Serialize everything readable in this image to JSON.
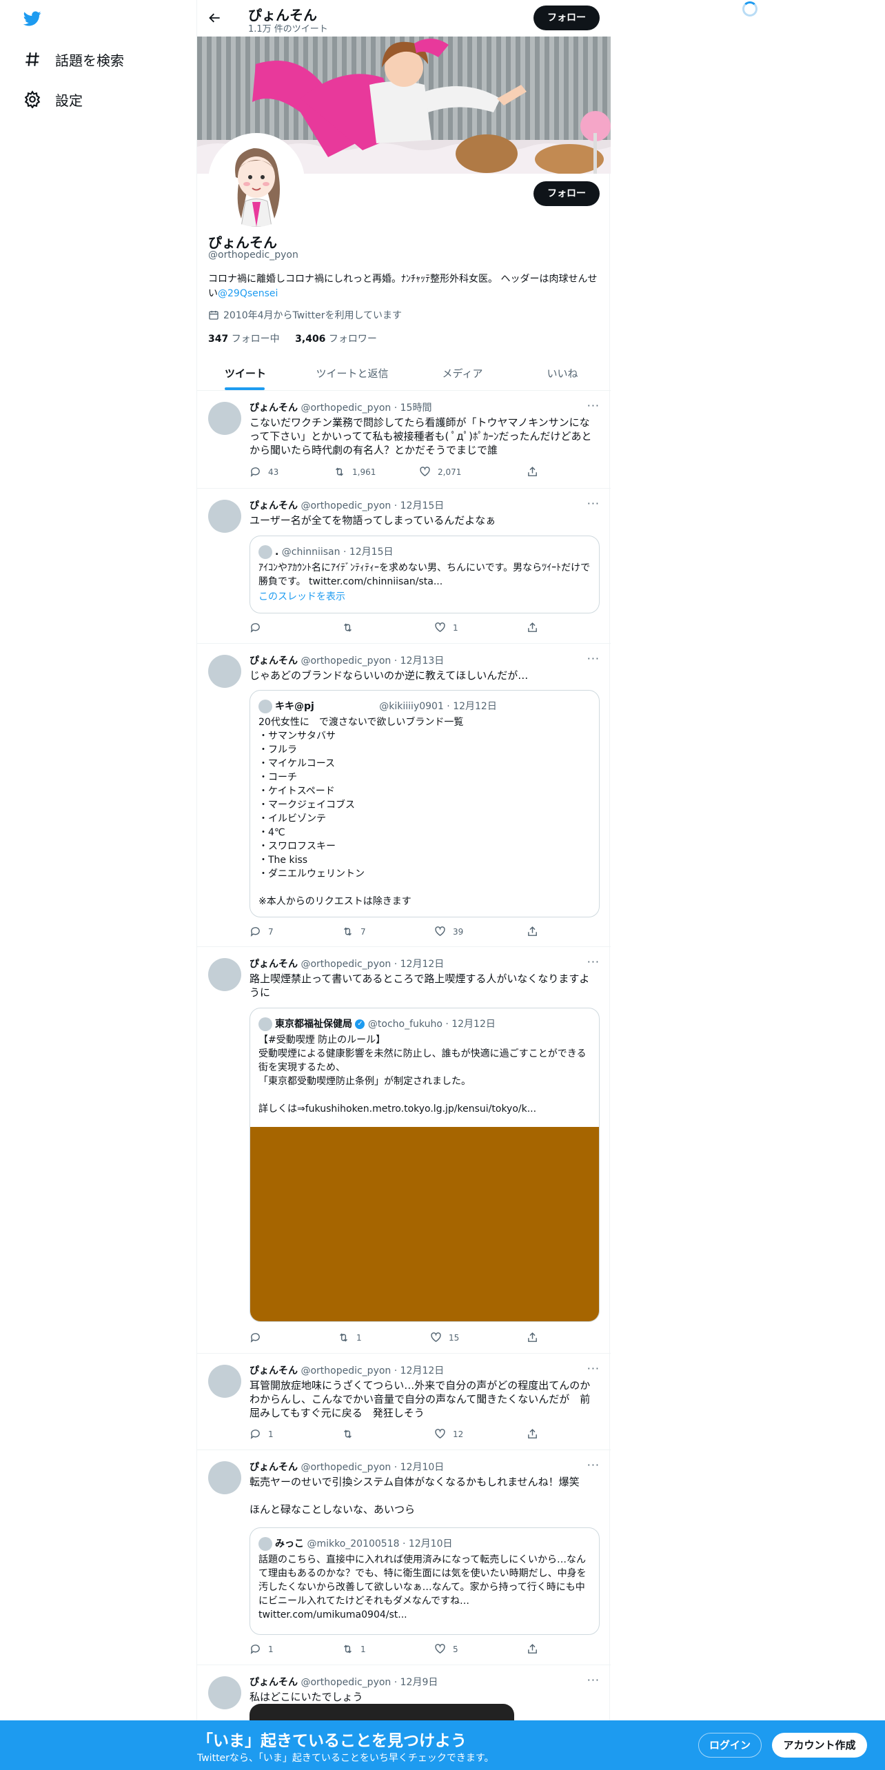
{
  "nav": {
    "explore_label": "話題を検索",
    "settings_label": "設定"
  },
  "header": {
    "name": "ぴょんそん",
    "tweet_count": "1.1万 件のツイート",
    "follow_label": "フォロー"
  },
  "profile": {
    "name": "ぴょんそん",
    "handle": "@orthopedic_pyon",
    "bio": "コロナ禍に離婚しコロナ禍にしれっと再婚。ﾅﾝﾁｬｯﾃ整形外科女医。 ヘッダーは肉球せんせい",
    "bio_link": "@29Qsensei",
    "joined": "2010年4月からTwitterを利用しています",
    "following_count": "347",
    "following_label": "フォロー中",
    "followers_count": "3,406",
    "followers_label": "フォロワー",
    "follow_label": "フォロー"
  },
  "tabs": [
    "ツイート",
    "ツイートと返信",
    "メディア",
    "いいね"
  ],
  "tweets": [
    {
      "name": "ぴょんそん",
      "meta": "@orthopedic_pyon · 15時間",
      "text": "こないだワクチン業務で問診してたら看護師が「トウヤマノキンサンになって下さい」とかいってて私も被接種者も( ﾟдﾟ)ﾎﾟｶｰﾝだったんだけどあとから聞いたら時代劇の有名人？とかだそうでまじで誰",
      "reply": "43",
      "retweet": "1,961",
      "like": "2,071"
    },
    {
      "name": "ぴょんそん",
      "meta": "@orthopedic_pyon · 12月15日",
      "text": "ユーザー名が全てを物語ってしまっているんだよなぁ",
      "reply": "",
      "retweet": "",
      "like": "1",
      "quote": {
        "name": ".",
        "meta": "@chinniisan · 12月15日",
        "text": "ｱｲｺﾝやｱｶｳﾝﾄ名にｱｲﾃﾞﾝﾃｨﾃｨｰを求めない男、ちんにいです。男ならﾂｲｰﾄだけで勝負です。 twitter.com/chinniisan/sta...",
        "thread": "このスレッドを表示"
      }
    },
    {
      "name": "ぴょんそん",
      "meta": "@orthopedic_pyon · 12月13日",
      "text": "じゃあどのブランドならいいのか逆に教えてほしいんだが…",
      "reply": "7",
      "retweet": "7",
      "like": "39",
      "quote": {
        "name": "キキ@pj",
        "meta": "@kikiiiiy0901 · 12月12日",
        "text": "20代女性に　で渡さないで欲しいブランド一覧\n・サマンサタバサ\n・フルラ\n・マイケルコース\n・コーチ\n・ケイトスペード\n・マークジェイコブス\n・イルビゾンテ\n・4℃\n・スワロフスキー\n・The kiss\n・ダニエルウェリントン\n\n※本人からのリクエストは除きます"
      }
    },
    {
      "name": "ぴょんそん",
      "meta": "@orthopedic_pyon · 12月12日",
      "text": "路上喫煙禁止って書いてあるところで路上喫煙する人がいなくなりますように",
      "reply": "",
      "retweet": "1",
      "like": "15",
      "quote": {
        "name": "東京都福祉保健局",
        "meta": "@tocho_fukuho · 12月12日",
        "text": "【#受動喫煙 防止のルール】\n受動喫煙による健康影響を未然に防止し、誰もが快適に過ごすことができる街を実現するため、\n「東京都受動喫煙防止条例」が制定されました。\n\n詳しくは⇒fukushihoken.metro.tokyo.lg.jp/kensui/tokyo/k...",
        "media_color": "#a66500"
      }
    },
    {
      "name": "ぴょんそん",
      "meta": "@orthopedic_pyon · 12月12日",
      "text": "耳管開放症地味にうざくてつらい…外来で自分の声がどの程度出てんのかわからんし、こんなでかい音量で自分の声なんて聞きたくないんだが　前屈みしてもすぐ元に戻る　発狂しそう",
      "reply": "1",
      "retweet": "",
      "like": "12"
    },
    {
      "name": "ぴょんそん",
      "meta": "@orthopedic_pyon · 12月10日",
      "text": "転売ヤーのせいで引換システム自体がなくなるかもしれませんね！爆笑\n\nほんと碌なことしないな、あいつら",
      "reply": "1",
      "retweet": "1",
      "like": "5",
      "quote": {
        "name": "みっこ",
        "meta": "@mikko_20100518 · 12月10日",
        "text": "話題のこちら、直接中に入れれば使用済みになって転売しにくいから…なんて理由もあるのかな？でも、特に衛生面には気を使いたい時期だし、中身を汚したくないから改善して欲しいなぁ…なんて。家から持って行く時にも中にビニール入れてたけどそれもダメなんですね…\ntwitter.com/umikuma0904/st..."
      }
    },
    {
      "name": "ぴょんそん",
      "meta": "@orthopedic_pyon · 12月9日",
      "text": "私はどこにいたでしょう"
    }
  ],
  "bottom": {
    "title": "「いま」起きていることを見つけよう",
    "subtitle": "Twitterなら、「いま」起きていることをいち早くチェックできます。",
    "login_label": "ログイン",
    "signup_label": "アカウント作成"
  },
  "colors": {
    "accent": "#1d9bf0",
    "dark": "#0f1419",
    "muted": "#536471",
    "banner_stripe": "#9fa5a7",
    "banner_pink": "#e8399b"
  }
}
